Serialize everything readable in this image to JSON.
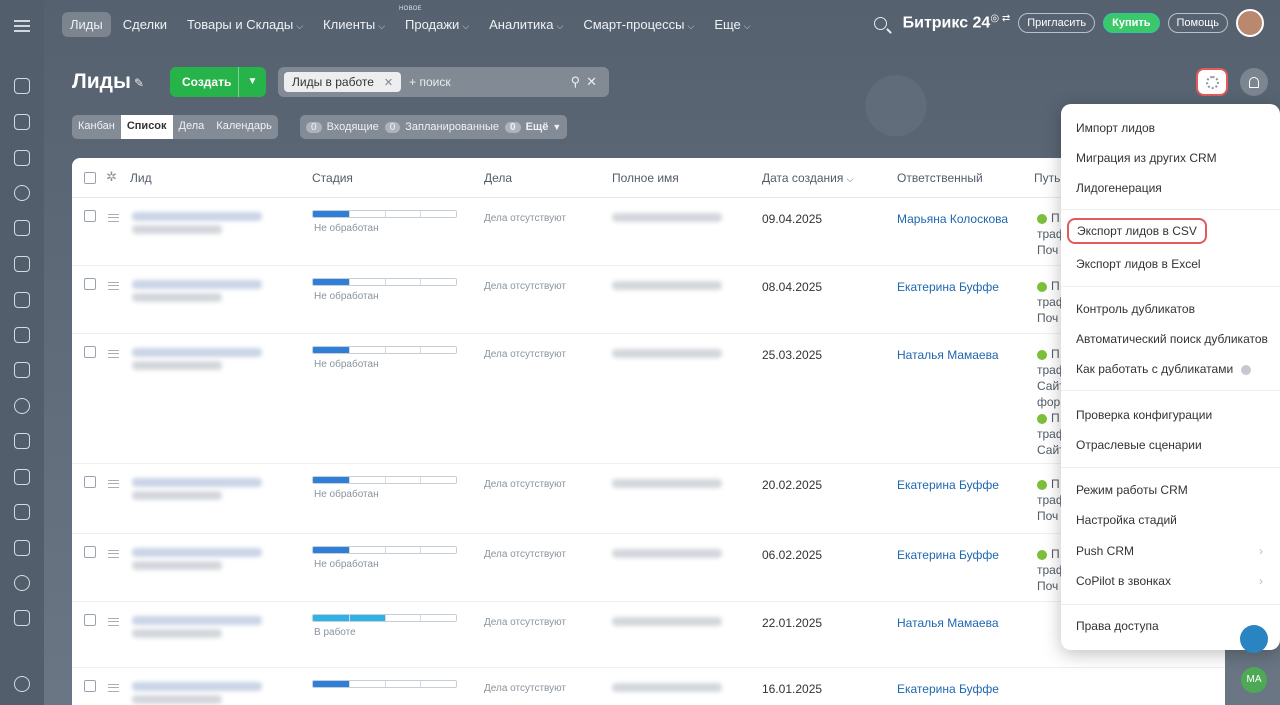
{
  "topnav": {
    "items": [
      {
        "label": "Лиды",
        "active": true,
        "dropdown": false
      },
      {
        "label": "Сделки",
        "dropdown": false
      },
      {
        "label": "Товары и Склады",
        "dropdown": true
      },
      {
        "label": "Клиенты",
        "dropdown": true
      },
      {
        "label": "Продажи",
        "dropdown": true,
        "tag": "НОВОЕ"
      },
      {
        "label": "Аналитика",
        "dropdown": true
      },
      {
        "label": "Смарт-процессы",
        "dropdown": true
      },
      {
        "label": "Еще",
        "dropdown": true
      }
    ],
    "logo": "Битрикс 24",
    "invite": "Пригласить",
    "buy": "Купить",
    "help": "Помощь"
  },
  "page": {
    "title": "Лиды",
    "create_label": "Создать",
    "filter_chip": "Лиды в работе",
    "search_placeholder": "+ поиск"
  },
  "viewtabs": [
    "Канбан",
    "Список",
    "Дела",
    "Календарь"
  ],
  "active_view": "Список",
  "counters": [
    {
      "n": "0",
      "label": "Входящие"
    },
    {
      "n": "0",
      "label": "Запланированные"
    },
    {
      "n": "0",
      "label": "Ещё"
    }
  ],
  "columns": {
    "lead": "Лид",
    "stage": "Стадия",
    "deals": "Дела",
    "fullname": "Полное имя",
    "created": "Дата создания",
    "responsible": "Ответственный",
    "path": "Путь"
  },
  "rows": [
    {
      "stage": "Не обработан",
      "stage_progress": 0.25,
      "deals": "Дела отсутствуют",
      "date": "09.04.2025",
      "resp": "Марьяна Колоскова",
      "path": [
        "П",
        "траф",
        "Поч"
      ]
    },
    {
      "stage": "Не обработан",
      "stage_progress": 0.25,
      "deals": "Дела отсутствуют",
      "date": "08.04.2025",
      "resp": "Екатерина Буффе",
      "path": [
        "П",
        "траф",
        "Поч"
      ]
    },
    {
      "stage": "Не обработан",
      "stage_progress": 0.25,
      "deals": "Дела отсутствуют",
      "date": "25.03.2025",
      "resp": "Наталья Мамаева",
      "path": [
        "П",
        "траф",
        "Сайт",
        "фор",
        "П",
        "траф",
        "Сайт"
      ]
    },
    {
      "stage": "Не обработан",
      "stage_progress": 0.25,
      "deals": "Дела отсутствуют",
      "date": "20.02.2025",
      "resp": "Екатерина Буффе",
      "path": [
        "П",
        "траф",
        "Поч"
      ]
    },
    {
      "stage": "Не обработан",
      "stage_progress": 0.25,
      "deals": "Дела отсутствуют",
      "date": "06.02.2025",
      "resp": "Екатерина Буффе",
      "path": [
        "П",
        "траф",
        "Поч"
      ]
    },
    {
      "stage": "В работе",
      "stage_progress": 0.5,
      "deals": "Дела отсутствуют",
      "date": "22.01.2025",
      "resp": "Наталья Мамаева",
      "path": []
    },
    {
      "stage": "",
      "stage_progress": 0.25,
      "deals": "Дела отсутствуют",
      "date": "16.01.2025",
      "resp": "Екатерина Буффе",
      "path": []
    }
  ],
  "menu": {
    "items": [
      "Импорт лидов",
      "Миграция из других CRM",
      "Лидогенерация",
      "Экспорт лидов в CSV",
      "Экспорт лидов в Excel",
      "Контроль дубликатов",
      "Автоматический поиск дубликатов",
      "Как работать с дубликатами",
      "Проверка конфигурации",
      "Отраслевые сценарии",
      "Режим работы CRM",
      "Настройка стадий",
      "Push CRM",
      "CoPilot в звонках",
      "Права доступа"
    ],
    "highlighted": "Экспорт лидов в CSV"
  },
  "user_badge": "MA",
  "colors": {
    "accent_green": "#26b34a",
    "highlight_red": "#e25a5a",
    "link_blue": "#2067b0"
  }
}
